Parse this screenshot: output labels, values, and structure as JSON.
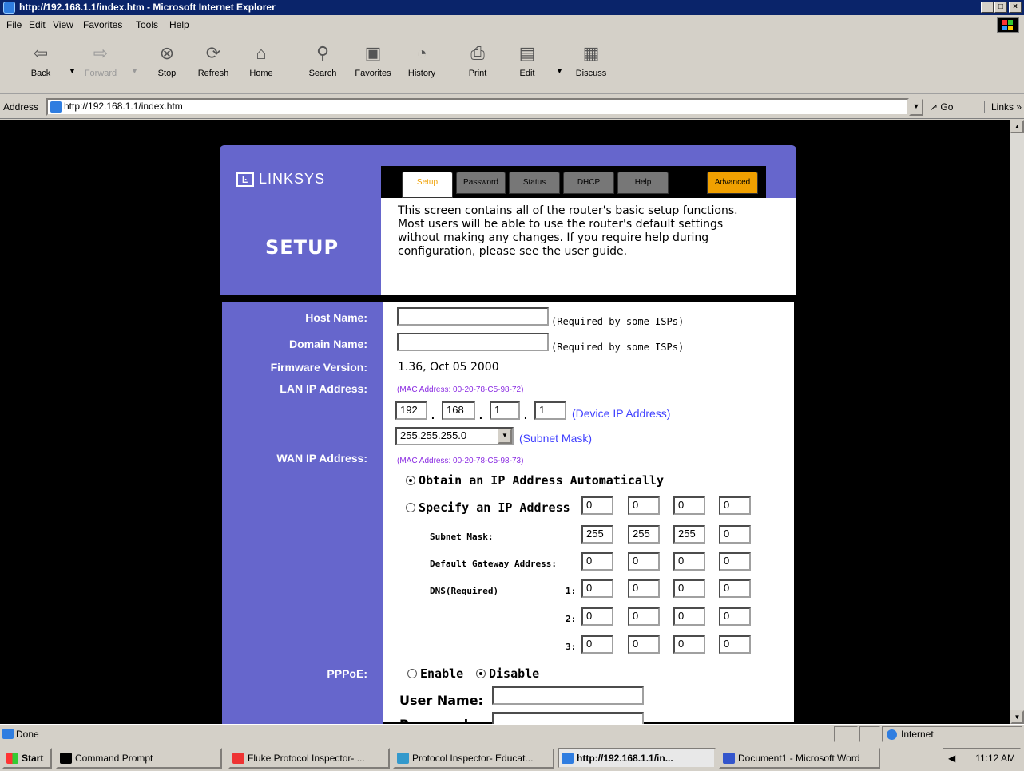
{
  "window": {
    "title": "http://192.168.1.1/index.htm - Microsoft Internet Explorer",
    "controls": [
      "_",
      "□",
      "×"
    ]
  },
  "menu": [
    "File",
    "Edit",
    "View",
    "Favorites",
    "Tools",
    "Help"
  ],
  "toolbar": {
    "back": "Back",
    "forward": "Forward",
    "stop": "Stop",
    "refresh": "Refresh",
    "home": "Home",
    "search": "Search",
    "favorites": "Favorites",
    "history": "History",
    "print": "Print",
    "edit": "Edit",
    "discuss": "Discuss"
  },
  "address": {
    "label": "Address",
    "url": "http://192.168.1.1/index.htm",
    "go": "Go",
    "links": "Links »"
  },
  "router": {
    "brand": "LINKSYS",
    "tabs": {
      "setup": "Setup",
      "password": "Password",
      "status": "Status",
      "dhcp": "DHCP",
      "help": "Help",
      "advanced": "Advanced"
    },
    "page_title": "SETUP",
    "description": "This screen contains all of the router's basic setup functions. Most users will be able to use the router's default settings without making any changes. If you require help during configuration, please see the user guide.",
    "host_name_label": "Host Name:",
    "host_name_value": "",
    "domain_name_label": "Domain Name:",
    "domain_name_value": "",
    "required_note": "(Required by some ISPs)",
    "firmware_label": "Firmware Version:",
    "firmware_value": "1.36, Oct 05 2000",
    "lan_label": "LAN IP Address:",
    "lan_mac": "(MAC Address: 00-20-78-C5-98-72)",
    "lan_ip": [
      "192",
      "168",
      "1",
      "1"
    ],
    "device_ip_note": "(Device IP Address)",
    "subnet_select_value": "255.255.255.0",
    "subnet_note": "(Subnet Mask)",
    "wan_label": "WAN IP Address:",
    "wan_mac": "(MAC Address: 00-20-78-C5-98-73)",
    "obtain_auto": "Obtain an IP Address Automatically",
    "specify_ip": "Specify an IP Address",
    "specify_ip_values": [
      "0",
      "0",
      "0",
      "0"
    ],
    "subnet_mask_label": "Subnet Mask:",
    "subnet_mask_values": [
      "255",
      "255",
      "255",
      "0"
    ],
    "gateway_label": "Default Gateway Address:",
    "gateway_values": [
      "0",
      "0",
      "0",
      "0"
    ],
    "dns_label": "DNS(Required)",
    "dns": [
      {
        "n": "1:",
        "values": [
          "0",
          "0",
          "0",
          "0"
        ]
      },
      {
        "n": "2:",
        "values": [
          "0",
          "0",
          "0",
          "0"
        ]
      },
      {
        "n": "3:",
        "values": [
          "0",
          "0",
          "0",
          "0"
        ]
      }
    ],
    "pppoe_label": "PPPoE:",
    "enable": "Enable",
    "disable": "Disable",
    "username_label": "User Name:",
    "username_value": "",
    "password_label": "Password:",
    "password_value": ""
  },
  "statusbar": {
    "text": "Done",
    "zone": "Internet"
  },
  "taskbar": {
    "start": "Start",
    "items": [
      "Command Prompt",
      "Fluke Protocol Inspector- ...",
      "Protocol Inspector- Educat...",
      "http://192.168.1.1/in...",
      "Document1 - Microsoft Word"
    ],
    "clock": "11:12 AM"
  }
}
